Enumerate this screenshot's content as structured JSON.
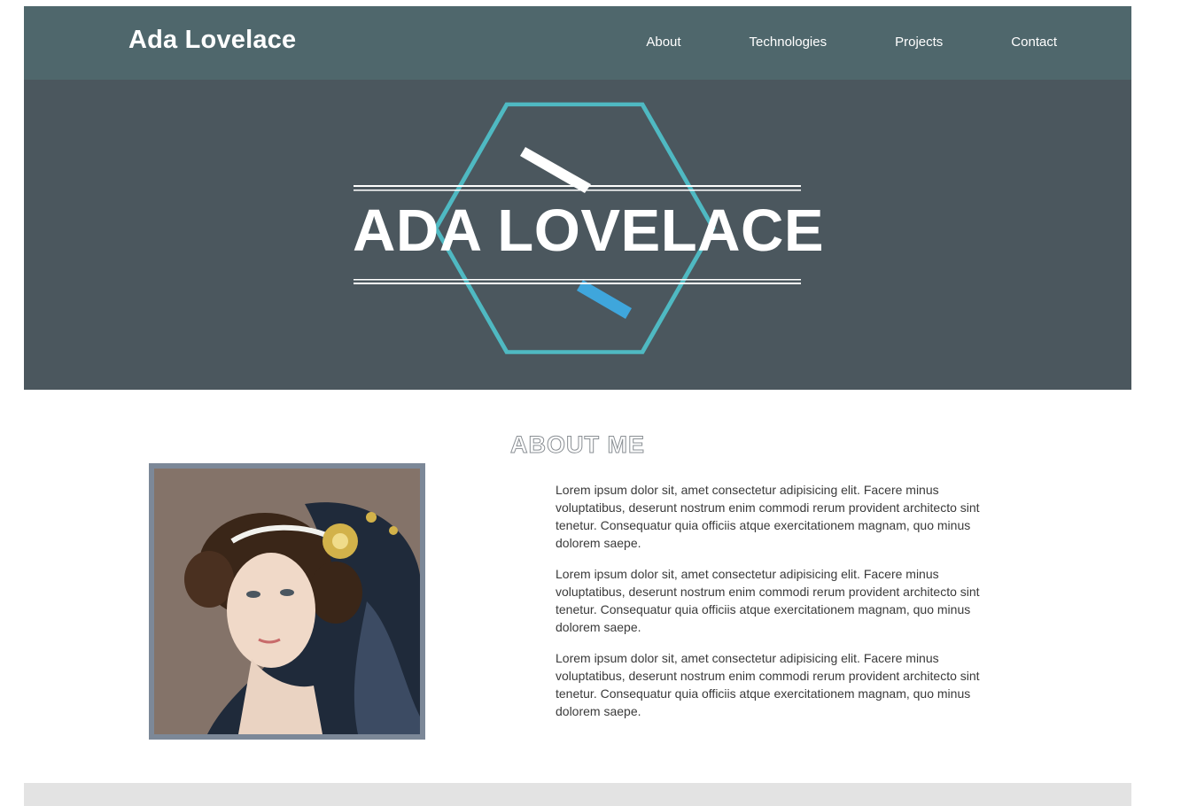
{
  "navbar": {
    "brand": "Ada Lovelace",
    "links": [
      {
        "label": "About"
      },
      {
        "label": "Technologies"
      },
      {
        "label": "Projects"
      },
      {
        "label": "Contact"
      }
    ],
    "background": "#4f676c"
  },
  "hero": {
    "title": "ADA LOVELACE",
    "background": "#4b575e",
    "logo_colors": {
      "hexagon": "#4fb9c2",
      "bar_top": "#ffffff",
      "bar_bottom": "#3fa6dc"
    }
  },
  "about": {
    "heading": "ABOUT ME",
    "portrait_alt": "portrait of Ada Lovelace",
    "paragraphs": [
      "Lorem ipsum dolor sit, amet consectetur adipisicing elit. Facere minus voluptatibus, deserunt nostrum enim commodi rerum provident architecto sint tenetur. Consequatur quia officiis atque exercitationem magnam, quo minus dolorem saepe.",
      "Lorem ipsum dolor sit, amet consectetur adipisicing elit. Facere minus voluptatibus, deserunt nostrum enim commodi rerum provident architecto sint tenetur. Consequatur quia officiis atque exercitationem magnam, quo minus dolorem saepe.",
      "Lorem ipsum dolor sit, amet consectetur adipisicing elit. Facere minus voluptatibus, deserunt nostrum enim commodi rerum provident architecto sint tenetur. Consequatur quia officiis atque exercitationem magnam, quo minus dolorem saepe."
    ]
  }
}
